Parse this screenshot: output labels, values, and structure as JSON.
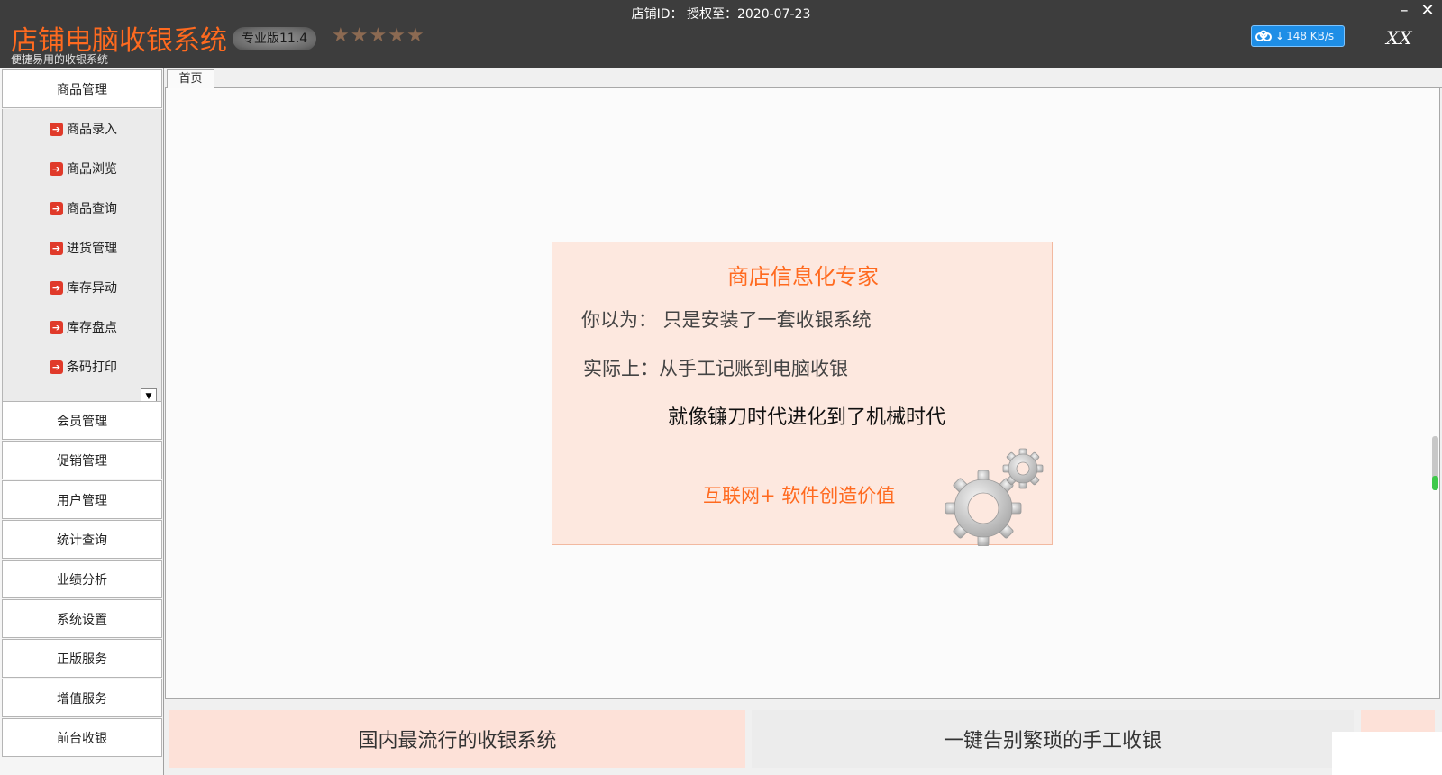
{
  "titlebar": {
    "app_title": "店铺电脑收银系统",
    "app_subtitle": "便捷易用的收银系统",
    "edition": "专业版11.4",
    "stars": [
      "★",
      "★",
      "★",
      "★",
      "★"
    ],
    "shop_info": "店铺ID： 授权至：2020-07-23",
    "minimize_glyph": "–",
    "close_glyph": "✕",
    "net_speed": "148 KB/s",
    "user_name": "XX",
    "accent_color": "#ff6a1f",
    "bar_color": "#3d3d3d"
  },
  "sidebar": {
    "headers": [
      "商品管理",
      "会员管理",
      "促销管理",
      "用户管理",
      "统计查询",
      "业绩分析",
      "系统设置",
      "正版服务",
      "增值服务",
      "前台收银"
    ],
    "sub_items": [
      "商品录入",
      "商品浏览",
      "商品查询",
      "进货管理",
      "库存异动",
      "库存盘点",
      "条码打印"
    ],
    "sub_icon": "arrow-right-icon",
    "scroll_glyph": "▼"
  },
  "tabs": {
    "home_label": "首页"
  },
  "promo": {
    "title": "商店信息化专家",
    "line1": "你以为：  只是安装了一套收银系统",
    "line2": "实际上：从手工记账到电脑收银",
    "line3": "就像镰刀时代进化到了机械时代",
    "slogan": "互联网+    软件创造价值",
    "bg_color": "#fde8df"
  },
  "banners": {
    "left_text": "国内最流行的收银系统",
    "right_text": "一键告别繁琐的手工收银"
  }
}
